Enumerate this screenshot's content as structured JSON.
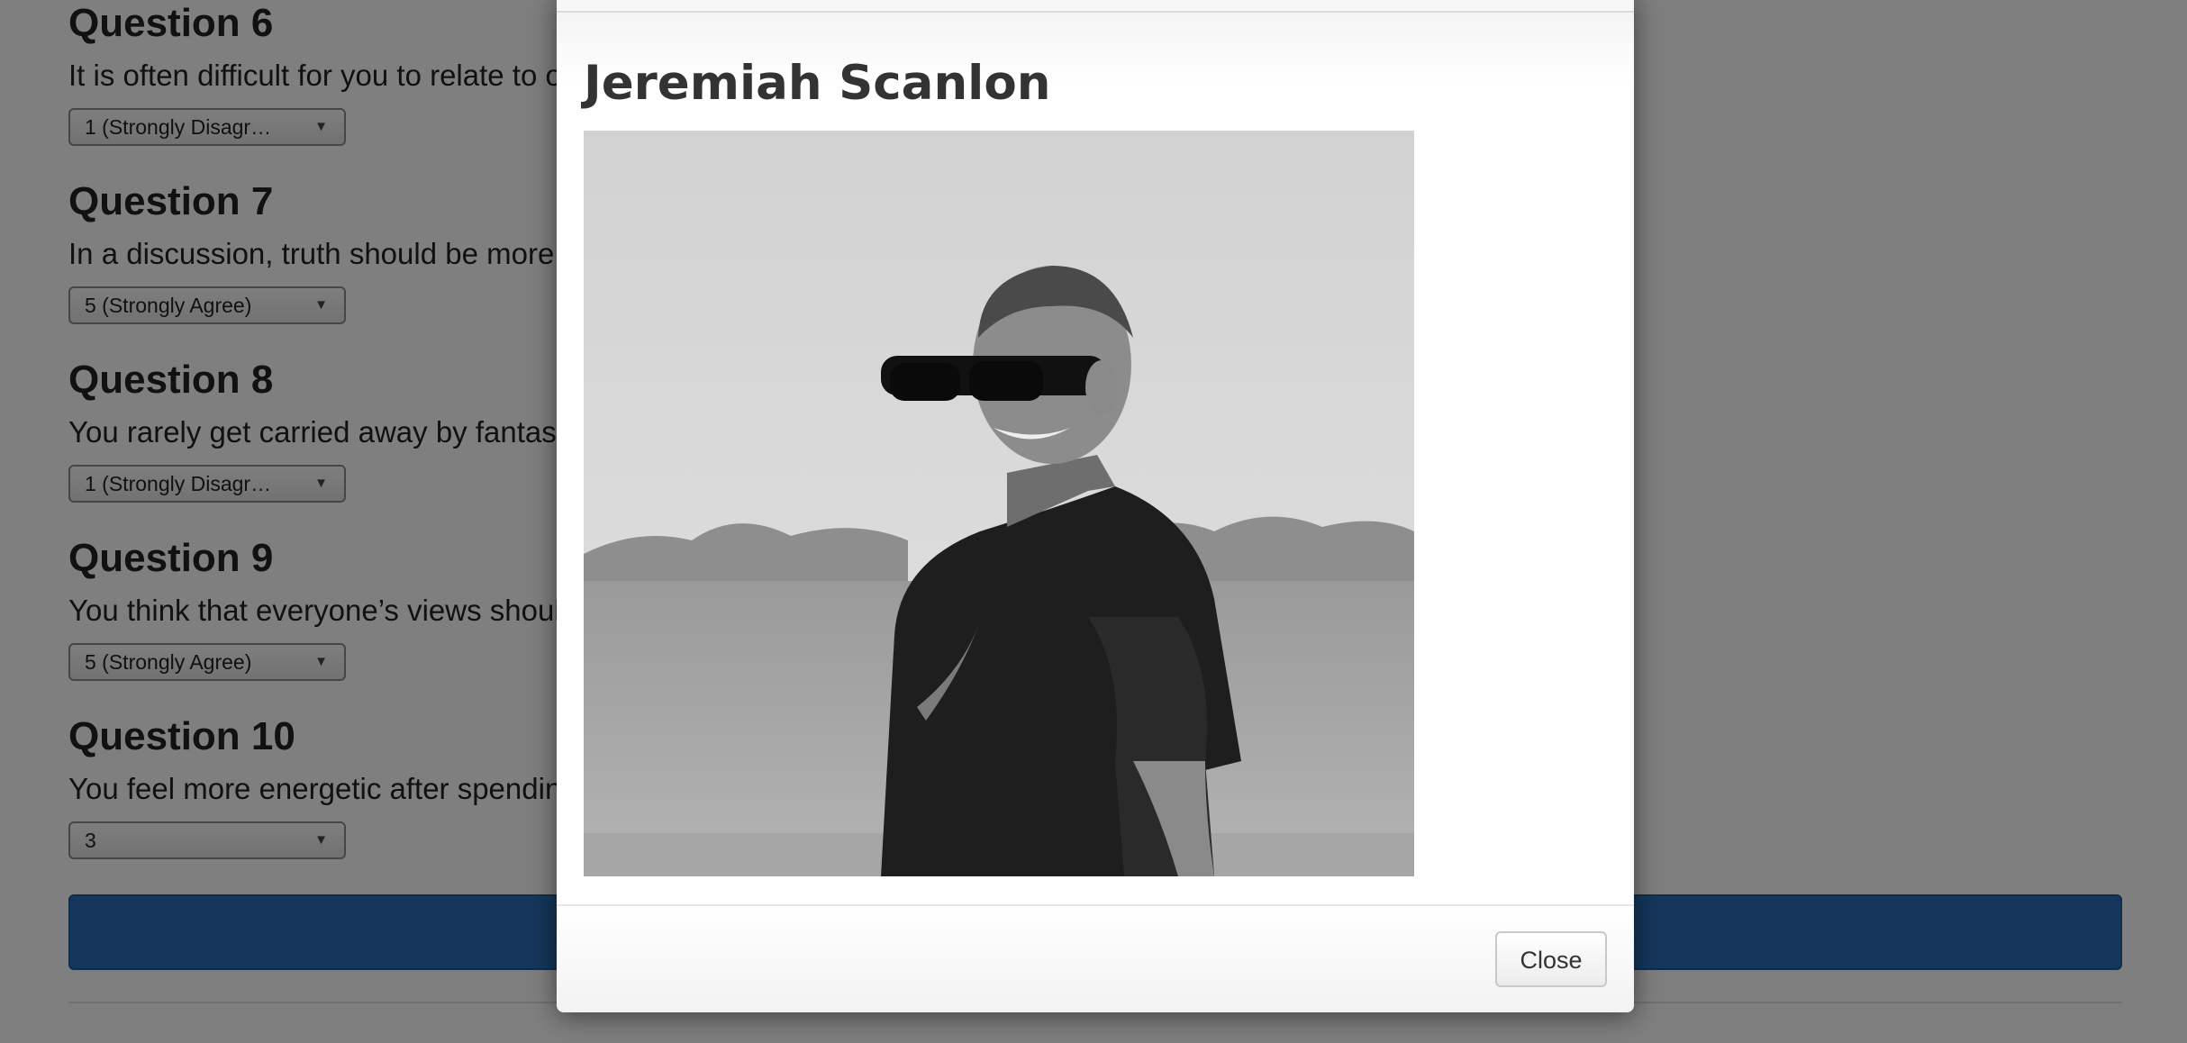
{
  "questions": [
    {
      "title": "Question 6",
      "text": "It is often difficult for you to relate to other people’s feelings.",
      "selected": "1 (Strongly Disagr…"
    },
    {
      "title": "Question 7",
      "text": "In a discussion, truth should be more important than people’s sensitivities.",
      "selected": "5 (Strongly Agree)"
    },
    {
      "title": "Question 8",
      "text": "You rarely get carried away by fantasies and ideas.",
      "selected": "1 (Strongly Disagr…"
    },
    {
      "title": "Question 9",
      "text": "You think that everyone’s views should be respected regardless of whether they are supported by facts or not.",
      "selected": "5 (Strongly Agree)"
    },
    {
      "title": "Question 10",
      "text": "You feel more energetic after spending time with a group of people.",
      "selected": "3"
    }
  ],
  "modal": {
    "name": "Jeremiah Scanlon",
    "photo_icon": "profile-photo",
    "close_label": "Close"
  },
  "colors": {
    "submit_bar": "#2a6fb6",
    "backdrop": "rgba(0,0,0,0.5)"
  }
}
